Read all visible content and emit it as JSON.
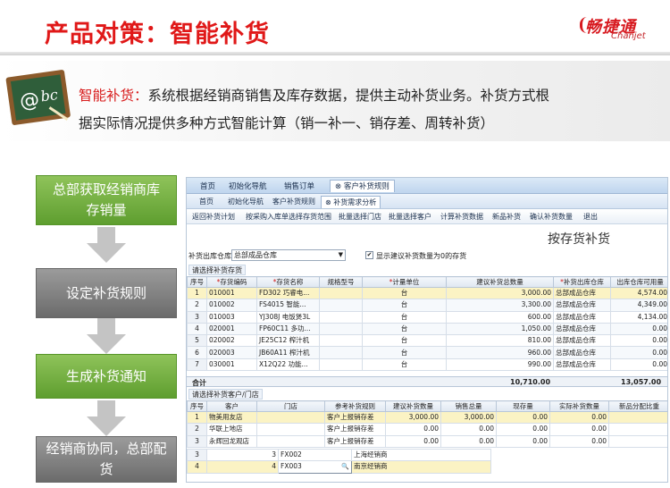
{
  "slide": {
    "title": "产品对策：智能补货",
    "logo_cn": "畅捷通",
    "logo_en": "Chanjet"
  },
  "intro": {
    "keyword": "智能补货：",
    "line1_rest": "系统根据经销商销售及库存数据，提供主动补货业务。补货方式根",
    "line2": "据实际情况提供多种方式智能计算（销一补一、销存差、周转补货）"
  },
  "flow": {
    "steps": [
      "总部获取经销商库存销量",
      "设定补货规则",
      "生成补货通知",
      "经销商协同，总部配货"
    ],
    "step1_l1": "总部获取经销商库",
    "step1_l2": "存销量",
    "step4_l1": "经销商协同，总部配",
    "step4_l2": "货"
  },
  "app": {
    "tabs": [
      "首页",
      "初始化导航",
      "销售订单",
      "客户补货规则"
    ],
    "tab_closable_index": 3,
    "subtabs": [
      "首页",
      "初始化导航",
      "客户补货规则",
      "补货需求分析"
    ],
    "toolbar": [
      "返回补货计划",
      "按采购入库单选择存货范围",
      "批量选择门店",
      "批量选择客户",
      "计算补货数据",
      "新品补货",
      "确认补货数量",
      "退出"
    ],
    "form_title": "按存货补货",
    "filter": {
      "label": "补货出库仓库",
      "value": "总部成品仓库",
      "checkbox_checked": true,
      "checkbox_label": "显示建议补货数量为0的存货"
    },
    "section1": "请选择补货存货",
    "grid1": {
      "headers": [
        "序号",
        "*存货编码",
        "*存货名称",
        "规格型号",
        "*计量单位",
        "建议补货总数量",
        "*补货出库仓库",
        "出库仓库可用量"
      ],
      "rows": [
        [
          "1",
          "010001",
          "FD302 巧睿电...",
          "",
          "台",
          "3,000.00",
          "总部成品仓库",
          "4,574.00"
        ],
        [
          "2",
          "010002",
          "FS4015 智能...",
          "",
          "台",
          "3,300.00",
          "总部成品仓库",
          "4,349.00"
        ],
        [
          "3",
          "010003",
          "YJ308J 电饭煲3L",
          "",
          "台",
          "600.00",
          "总部成品仓库",
          "4,134.00"
        ],
        [
          "4",
          "020001",
          "FP60C11 多功...",
          "",
          "台",
          "1,050.00",
          "总部成品仓库",
          "0.00"
        ],
        [
          "5",
          "020002",
          "JE25C12 榨汁机",
          "",
          "台",
          "810.00",
          "总部成品仓库",
          "0.00"
        ],
        [
          "6",
          "020003",
          "JB60A11 榨汁机",
          "",
          "台",
          "960.00",
          "总部成品仓库",
          "0.00"
        ],
        [
          "7",
          "030001",
          "X12Q22 功能...",
          "",
          "台",
          "990.00",
          "总部成品仓库",
          "0.00"
        ]
      ]
    },
    "total": {
      "label": "合计",
      "qty": "10,710.00",
      "avail": "13,057.00"
    },
    "section2": "请选择补货客户/门店",
    "grid2": {
      "headers": [
        "序号",
        "客户",
        "门店",
        "参考补货规则",
        "建议补货数量",
        "销售总量",
        "现存量",
        "实际补货数量",
        "新品分配比重"
      ],
      "rows": [
        [
          "1",
          "物美用友店",
          "",
          "客户上报销存差",
          "3,000.00",
          "3,000.00",
          "0.00",
          "0.00",
          ""
        ],
        [
          "2",
          "华联上地店",
          "",
          "客户上报销存差",
          "0.00",
          "0.00",
          "0.00",
          "0.00",
          ""
        ],
        [
          "3",
          "永辉回龙观店",
          "",
          "客户上报销存差",
          "0.00",
          "0.00",
          "0.00",
          "0.00",
          ""
        ]
      ]
    },
    "overlay_rows": [
      [
        "3",
        "3",
        "FX002",
        "上海经销商"
      ],
      [
        "4",
        "4",
        "FX003",
        "南京经销商"
      ]
    ]
  },
  "colors": {
    "title_red": "#e01818",
    "flow_green": "#6aa83a",
    "flow_gray": "#7d7d7d",
    "grid_selected": "#fbf3c4"
  }
}
